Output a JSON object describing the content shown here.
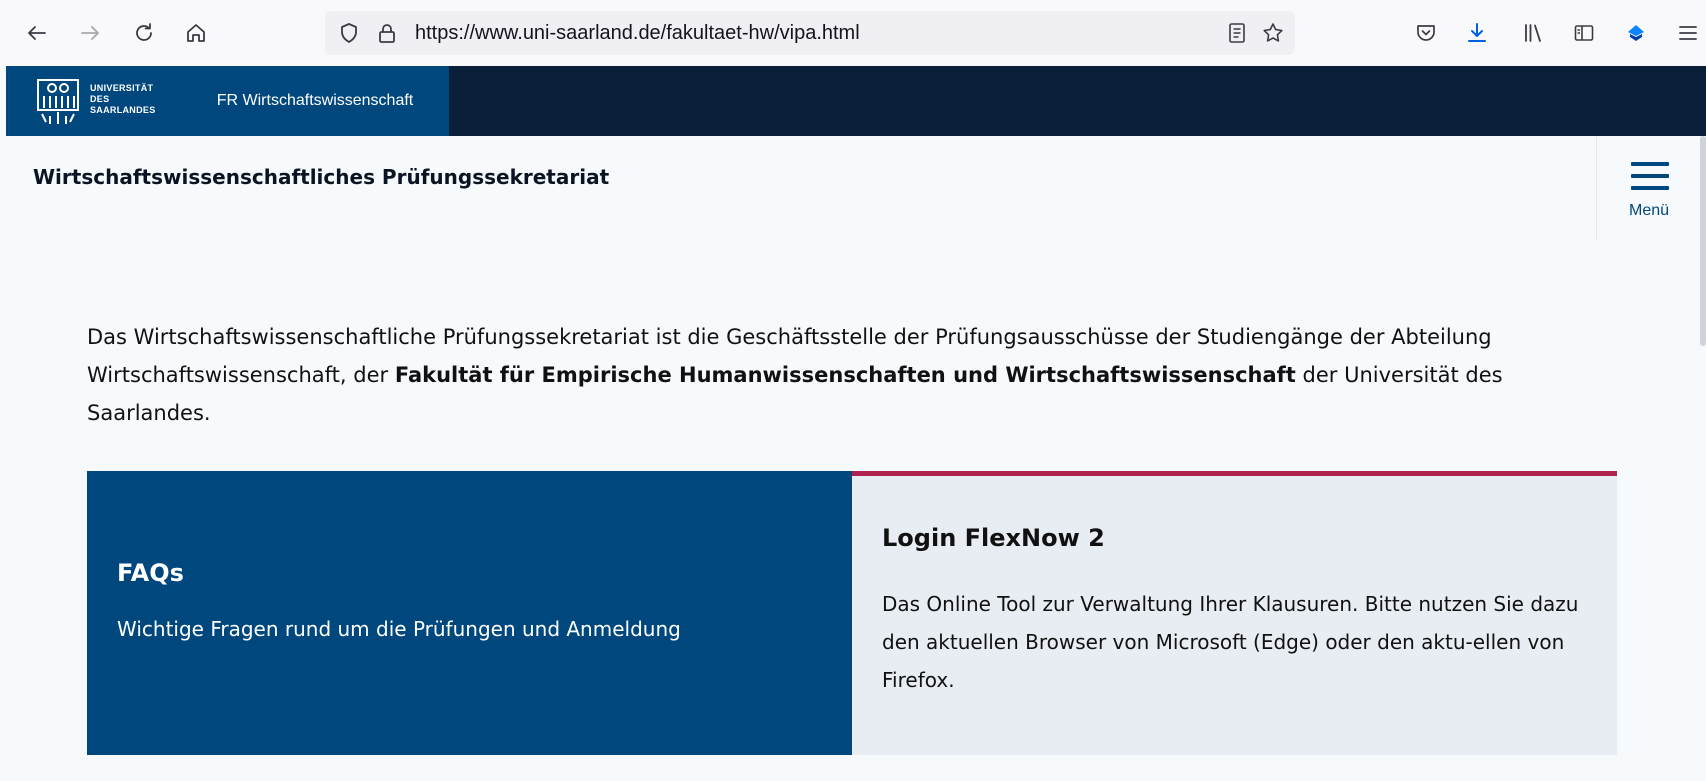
{
  "browser": {
    "url": "https://www.uni-saarland.de/fakultaet-hw/vipa.html",
    "toolbar_icons": [
      "back-arrow",
      "forward-arrow",
      "reload",
      "home",
      "shield",
      "lock",
      "reader-view",
      "bookmark-star",
      "pocket",
      "download",
      "library",
      "sidebar",
      "extension",
      "hamburger-menu"
    ]
  },
  "header": {
    "logo_line1": "UNIVERSITÄT",
    "logo_line2": "DES",
    "logo_line3": "SAARLANDES",
    "faculty_tab": "FR Wirtschaftswissenschaft"
  },
  "subheader": {
    "title": "Wirtschaftswissenschaftliches Prüfungssekretariat",
    "menu_label": "Menü"
  },
  "intro": {
    "text_before": "Das Wirtschaftswissenschaftliche Prüfungssekretariat ist die Geschäftsstelle der Prüfungsausschüsse der Studiengänge der Abteilung Wirtschaftswissenschaft, der ",
    "bold": "Fakultät für Empirische Humanwissenschaften und Wirtschaftswissenschaft",
    "text_after": " der Universität des Saarlandes."
  },
  "cards": [
    {
      "title": "FAQs",
      "description": "Wichtige Fragen rund um die Prüfungen und Anmeldung"
    },
    {
      "title": "Login FlexNow 2",
      "description": "Das Online Tool zur Verwaltung Ihrer Klausuren. Bitte nutzen Sie dazu den aktuellen Browser von Microsoft (Edge) oder den aktu-ellen von Firefox."
    }
  ],
  "colors": {
    "navy": "#0b1f3a",
    "brand_blue": "#00477e",
    "accent_red": "#b1234f",
    "card_light": "#e8ecf3",
    "page_bg": "#f6fafc"
  }
}
